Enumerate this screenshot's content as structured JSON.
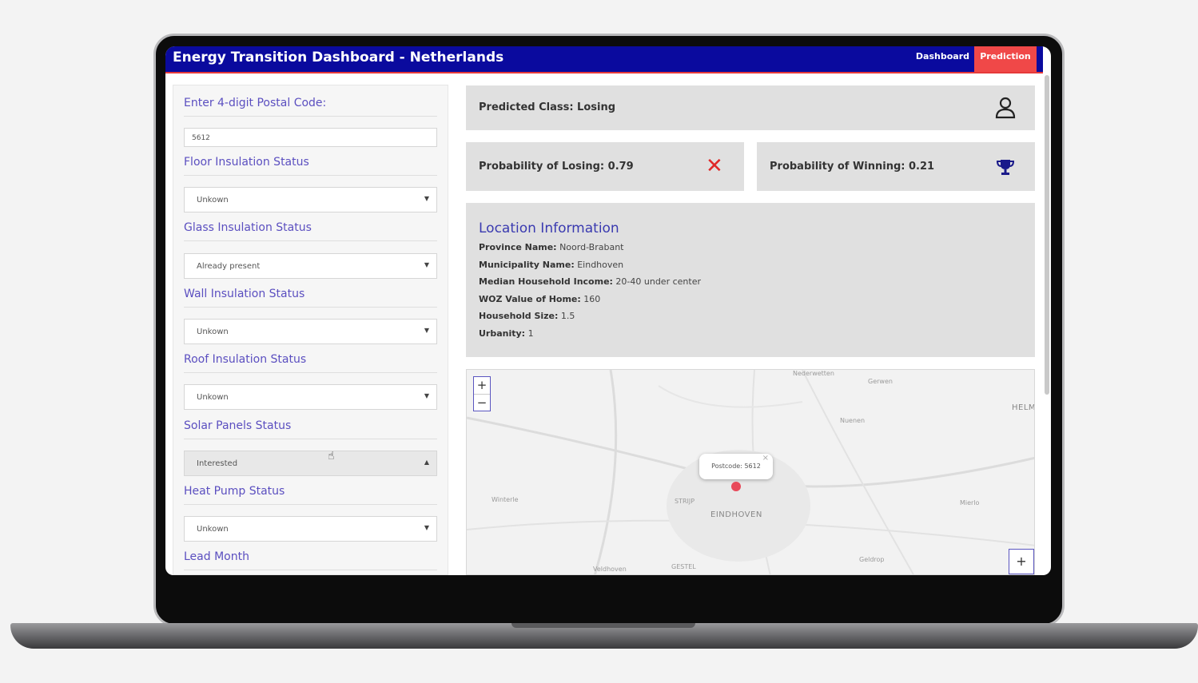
{
  "header": {
    "title": "Energy Transition Dashboard - Netherlands",
    "nav": {
      "dashboard": "Dashboard",
      "prediction": "Prediction"
    }
  },
  "sidebar": {
    "postal_label": "Enter 4-digit Postal Code:",
    "postal_value": "5612",
    "floor": {
      "label": "Floor Insulation Status",
      "value": "Unkown"
    },
    "glass": {
      "label": "Glass Insulation Status",
      "value": "Already present"
    },
    "wall": {
      "label": "Wall Insulation Status",
      "value": "Unkown"
    },
    "roof": {
      "label": "Roof Insulation Status",
      "value": "Unkown"
    },
    "solar": {
      "label": "Solar Panels Status",
      "value": "Interested"
    },
    "heat": {
      "label": "Heat Pump Status",
      "value": "Unkown"
    },
    "lead_month": {
      "label": "Lead Month"
    }
  },
  "prediction": {
    "predicted_class": "Predicted Class: Losing",
    "prob_losing": "Probability of Losing: 0.79",
    "prob_winning": "Probability of Winning: 0.21"
  },
  "location": {
    "title": "Location Information",
    "rows": [
      {
        "key": "Province Name:",
        "value": "Noord-Brabant"
      },
      {
        "key": "Municipality Name:",
        "value": "Eindhoven"
      },
      {
        "key": "Median Household Income:",
        "value": "20-40 under center"
      },
      {
        "key": "WOZ Value of Home:",
        "value": "160"
      },
      {
        "key": "Household Size:",
        "value": "1.5"
      },
      {
        "key": "Urbanity:",
        "value": "1"
      }
    ]
  },
  "map": {
    "popup": "Postcode: 5612",
    "labels": {
      "nederwetten": "Nederwetten",
      "gerwen": "Gerwen",
      "nuenen": "Nuenen",
      "helm": "HELM",
      "winterle": "Winterle",
      "strijp": "STRIJP",
      "eindhoven": "EINDHOVEN",
      "mierlo": "Mierlo",
      "geldrop": "Geldrop",
      "veldhoven": "Veldhoven",
      "gestel": "GESTEL"
    }
  },
  "colors": {
    "header_bg": "#0a0a9e",
    "accent_red": "#f04848",
    "label_purple": "#5b4fc0",
    "marker": "#e84a5a"
  },
  "icons": {
    "losing": "x-icon",
    "winning": "trophy-icon",
    "class": "person-icon"
  }
}
